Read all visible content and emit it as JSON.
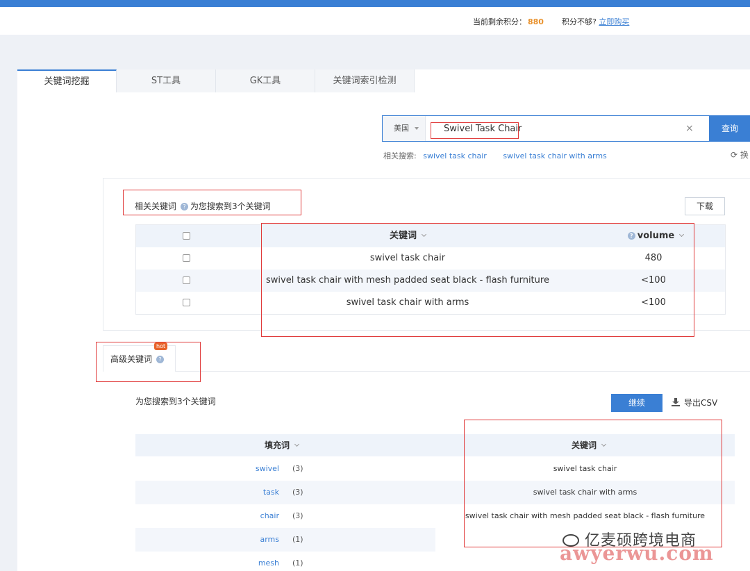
{
  "credits": {
    "label": "当前剩余积分：",
    "value": "880",
    "lack_label": "积分不够?",
    "buy_link": "立即购买"
  },
  "tabs": [
    {
      "label": "关键词挖掘"
    },
    {
      "label": "ST工具"
    },
    {
      "label": "GK工具"
    },
    {
      "label": "关键词索引检测"
    }
  ],
  "search": {
    "country": "美国",
    "query": "Swivel Task Chair",
    "clear": "×",
    "submit": "查询"
  },
  "related_search": {
    "label": "相关搜索:",
    "items": [
      "swivel task chair",
      "swivel task chair with arms"
    ],
    "refresh": "换"
  },
  "related_keywords": {
    "title": "相关关键词",
    "found": "为您搜索到3个关键词",
    "download": "下载",
    "columns": {
      "keyword": "关键词",
      "volume": "volume"
    },
    "rows": [
      {
        "keyword": "swivel task chair",
        "volume": "480"
      },
      {
        "keyword": "swivel task chair with mesh padded seat black - flash furniture",
        "volume": "<100"
      },
      {
        "keyword": "swivel task chair with arms",
        "volume": "<100"
      }
    ]
  },
  "advanced": {
    "tab_label": "高级关键词",
    "badge": "hot",
    "found": "为您搜索到3个关键词",
    "continue": "继续",
    "export": "导出CSV",
    "columns": {
      "filler": "填充词",
      "keyword": "关键词"
    },
    "filler_words": [
      {
        "word": "swivel",
        "count": "(3)"
      },
      {
        "word": "task",
        "count": "(3)"
      },
      {
        "word": "chair",
        "count": "(3)"
      },
      {
        "word": "arms",
        "count": "(1)"
      },
      {
        "word": "mesh",
        "count": "(1)"
      }
    ],
    "keywords": [
      "swivel task chair",
      "swivel task chair with arms",
      "swivel task chair with mesh padded seat black - flash furniture"
    ]
  },
  "watermark": {
    "cn": "亿麦硕跨境电商",
    "en": "awyerwu.com"
  },
  "colors": {
    "accent": "#3a7fd4",
    "highlight": "#e8902a",
    "annotation": "#e03a3a"
  }
}
